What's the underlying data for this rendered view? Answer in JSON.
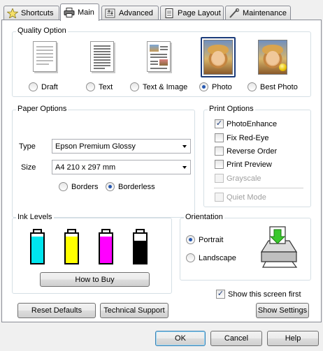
{
  "tabs": [
    {
      "label": "Shortcuts",
      "icon": "star-icon"
    },
    {
      "label": "Main",
      "icon": "printer-icon"
    },
    {
      "label": "Advanced",
      "icon": "settings-icon"
    },
    {
      "label": "Page Layout",
      "icon": "page-layout-icon"
    },
    {
      "label": "Maintenance",
      "icon": "wrench-icon"
    }
  ],
  "active_tab": "Main",
  "quality": {
    "title": "Quality Option",
    "options": [
      {
        "label": "Draft",
        "selected": false
      },
      {
        "label": "Text",
        "selected": false
      },
      {
        "label": "Text & Image",
        "selected": false
      },
      {
        "label": "Photo",
        "selected": true
      },
      {
        "label": "Best Photo",
        "selected": false
      }
    ]
  },
  "paper": {
    "title": "Paper Options",
    "type_label": "Type",
    "type_value": "Epson Premium Glossy",
    "size_label": "Size",
    "size_value": "A4 210 x 297 mm",
    "borders_label": "Borders",
    "borderless_label": "Borderless",
    "borderless_selected": true
  },
  "print": {
    "title": "Print Options",
    "photo_enhance": {
      "label": "PhotoEnhance",
      "checked": true
    },
    "fix_red_eye": {
      "label": "Fix Red-Eye",
      "checked": false
    },
    "reverse_order": {
      "label": "Reverse Order",
      "checked": false
    },
    "print_preview": {
      "label": "Print Preview",
      "checked": false
    },
    "grayscale": {
      "label": "Grayscale",
      "checked": false,
      "enabled": false
    },
    "quiet_mode": {
      "label": "Quiet Mode",
      "checked": false,
      "enabled": false
    }
  },
  "ink": {
    "title": "Ink Levels",
    "bottles": [
      {
        "name": "cyan",
        "color": "#00e5ee",
        "level": 0.9
      },
      {
        "name": "yellow",
        "color": "#ffff00",
        "level": 0.9
      },
      {
        "name": "magenta",
        "color": "#ff00ff",
        "level": 0.9
      },
      {
        "name": "black",
        "color": "#000000",
        "level": 0.75
      }
    ],
    "how_to_buy": "How to Buy"
  },
  "orientation": {
    "title": "Orientation",
    "portrait": "Portrait",
    "landscape": "Landscape",
    "portrait_selected": true
  },
  "show_screen_first": {
    "label": "Show this screen first",
    "checked": true
  },
  "buttons": {
    "reset_defaults": "Reset Defaults",
    "technical_support": "Technical Support",
    "show_settings": "Show Settings",
    "ok": "OK",
    "cancel": "Cancel",
    "help": "Help"
  }
}
